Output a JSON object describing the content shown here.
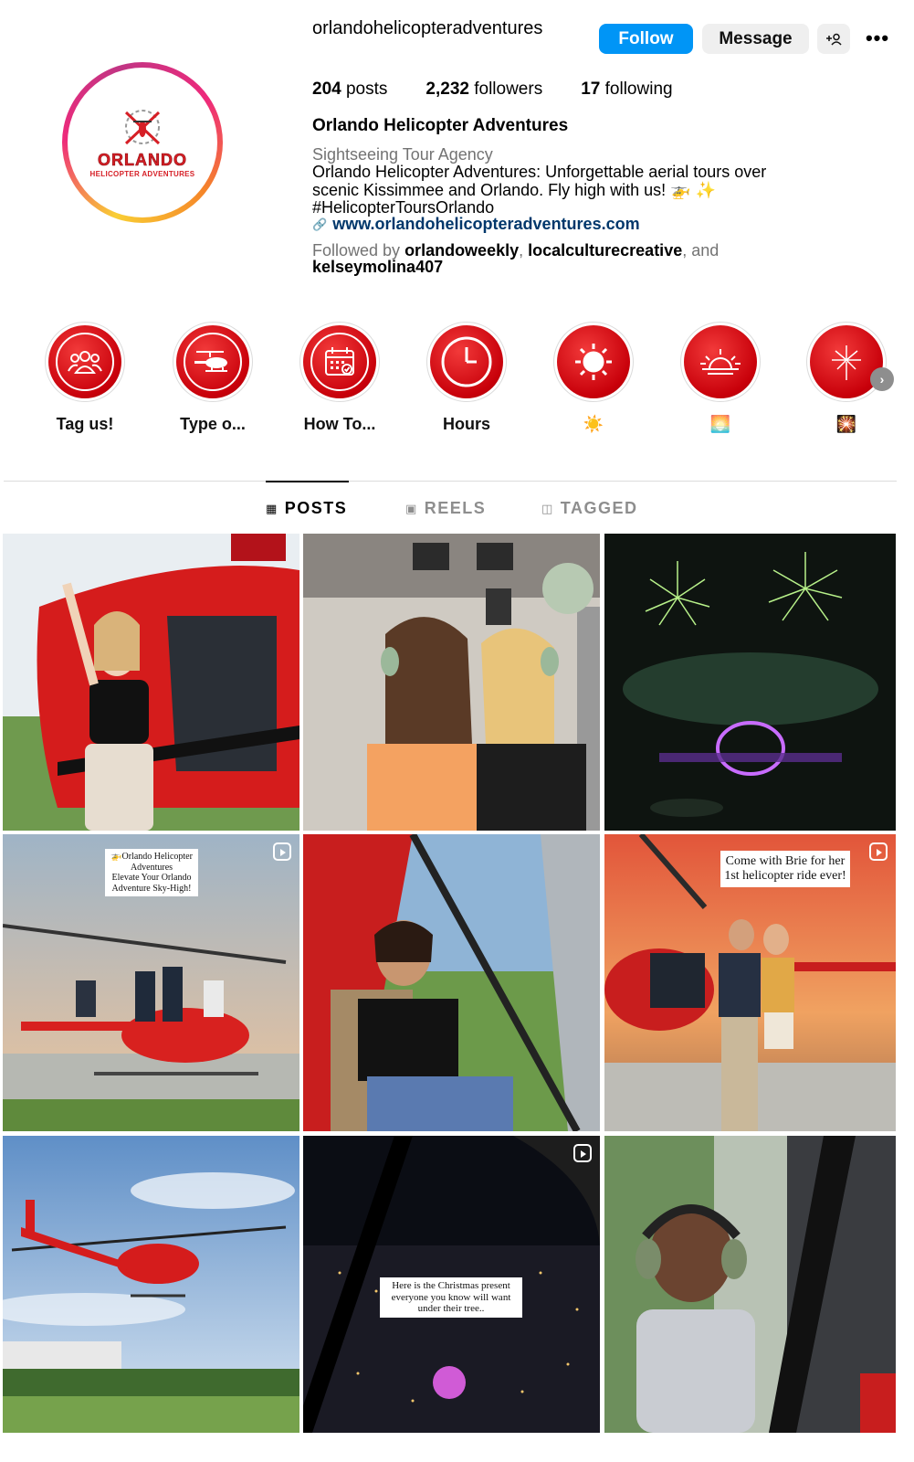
{
  "profile": {
    "username": "orlandohelicopteradventures",
    "logo_word": "ORLANDO",
    "logo_sub": "HELICOPTER ADVENTURES",
    "actions": {
      "follow": "Follow",
      "message": "Message"
    },
    "stats": {
      "posts_count": "204",
      "posts_label": "posts",
      "followers_count": "2,232",
      "followers_label": "followers",
      "following_count": "17",
      "following_label": "following"
    },
    "full_name": "Orlando Helicopter Adventures",
    "category": "Sightseeing Tour Agency",
    "bio": [
      "Orlando Helicopter Adventures: Unforgettable aerial tours over",
      "scenic Kissimmee and Orlando. Fly high with us! 🚁 ✨",
      "#HelicopterToursOrlando"
    ],
    "link": "www.orlandohelicopteradventures.com",
    "followed_by": {
      "prefix": "Followed by ",
      "user1": "orlandoweekly",
      "sep": ", ",
      "user2": "localculturecreative",
      "and": ", and",
      "user3": "kelseymolina407"
    }
  },
  "highlights": [
    {
      "label": "Tag us!",
      "icon": "people-icon"
    },
    {
      "label": "Type o...",
      "icon": "helicopter-icon"
    },
    {
      "label": "How To...",
      "icon": "calendar-icon"
    },
    {
      "label": "Hours",
      "icon": "clock-icon"
    },
    {
      "label": "☀️",
      "icon": "sun-icon"
    },
    {
      "label": "🌅",
      "icon": "sunset-icon"
    },
    {
      "label": "🎇",
      "icon": "fireworks-icon"
    }
  ],
  "tabs": [
    {
      "label": "POSTS",
      "active": true
    },
    {
      "label": "REELS",
      "active": false
    },
    {
      "label": "TAGGED",
      "active": false
    }
  ],
  "posts": {
    "captions": {
      "p4_title": "🚁Orlando Helicopter Adventures",
      "p4_sub": "Elevate Your Orlando Adventure Sky-High!",
      "p6": "Come with Brie for her 1st helicopter ride ever!",
      "p8": "Here is the Christmas present everyone you know will want under their tree.."
    }
  },
  "colors": {
    "follow_button": "#0095f6",
    "brand_red": "#d61f26",
    "link": "#00376b"
  }
}
